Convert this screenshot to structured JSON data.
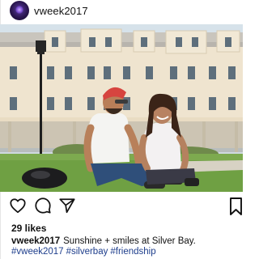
{
  "post": {
    "username": "vweek2017",
    "avatar_icon": "profile-avatar-icon",
    "photo_alt": "Two people smiling, sitting on grass in front of a building at Silver Bay",
    "likes_label": "29 likes",
    "caption": {
      "username": "vweek2017",
      "text": "Sunshine + smiles at Silver Bay."
    },
    "hashtags": [
      "#vweek2017",
      "#silverbay",
      "#friendship"
    ]
  },
  "actions": {
    "like_icon": "heart-icon",
    "comment_icon": "comment-icon",
    "share_icon": "share-icon",
    "save_icon": "bookmark-icon"
  },
  "colors": {
    "hashtag": "#1e3e8c",
    "avatar": "#2a1650"
  }
}
